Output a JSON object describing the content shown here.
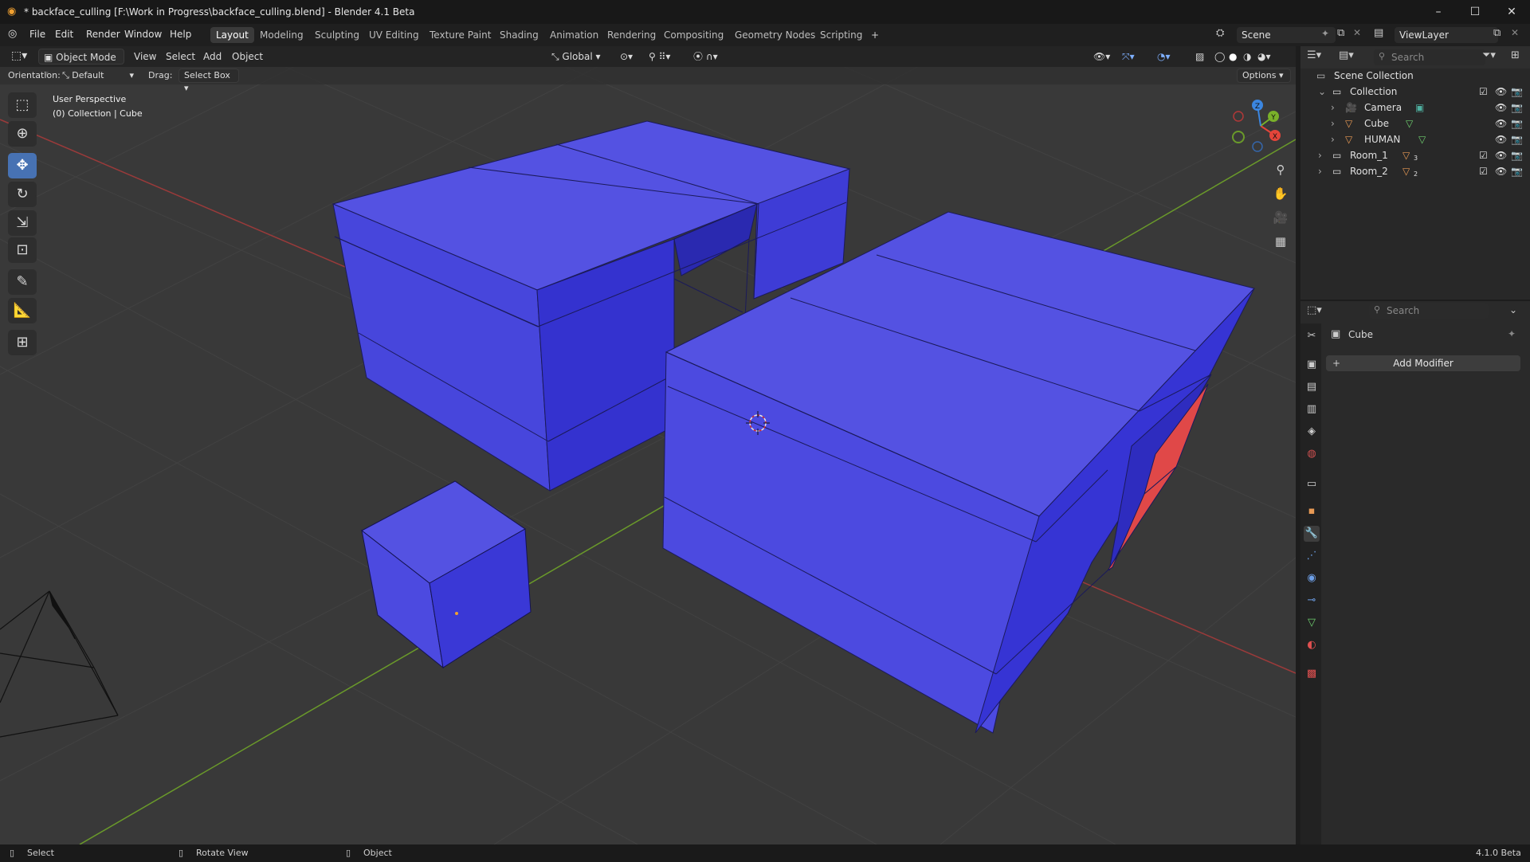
{
  "window": {
    "title": "* backface_culling [F:\\Work in Progress\\backface_culling.blend] - Blender 4.1 Beta",
    "controls": [
      "–",
      "☐",
      "✕"
    ]
  },
  "menubar": {
    "menus": [
      "File",
      "Edit",
      "Render",
      "Window",
      "Help"
    ],
    "workspaces": [
      "Layout",
      "Modeling",
      "Sculpting",
      "UV Editing",
      "Texture Paint",
      "Shading",
      "Animation",
      "Rendering",
      "Compositing",
      "Geometry Nodes",
      "Scripting"
    ],
    "active_workspace": "Layout",
    "add_workspace": "+",
    "scene": "Scene",
    "view_layer": "ViewLayer"
  },
  "viewport_header": {
    "mode": "Object Mode",
    "menus": [
      "View",
      "Select",
      "Add",
      "Object"
    ],
    "transform_orientation": "Global",
    "options_label": "Options"
  },
  "tool_settings": {
    "orientation_label": "Orientation:",
    "orientation_value": "Default",
    "drag_label": "Drag:",
    "drag_value": "Select Box"
  },
  "viewport_overlay": {
    "view_name": "User Perspective",
    "object_info": "(0) Collection | Cube"
  },
  "gizmo": {
    "axes": [
      "X",
      "Y",
      "Z"
    ]
  },
  "outliner": {
    "search_placeholder": "Search",
    "root": "Scene Collection",
    "items": [
      {
        "name": "Collection",
        "depth": 0
      },
      {
        "name": "Camera",
        "depth": 1
      },
      {
        "name": "Cube",
        "depth": 1
      },
      {
        "name": "HUMAN",
        "depth": 1
      },
      {
        "name": "Room_1",
        "depth": 0,
        "badge": "3"
      },
      {
        "name": "Room_2",
        "depth": 0,
        "badge": "2"
      }
    ]
  },
  "properties": {
    "search_placeholder": "Search",
    "object_name": "Cube",
    "add_modifier_label": "Add Modifier",
    "add_icon": "+"
  },
  "statusbar": {
    "items": [
      "Select",
      "Rotate View",
      "Object"
    ],
    "version": "4.1.0 Beta"
  },
  "colors": {
    "mesh_face": "#4b49e6",
    "backface_red": "#e04848",
    "active_tool": "#4772b3",
    "axis_x": "#e4453a",
    "axis_y": "#7ab12a",
    "axis_z": "#3b86e0"
  }
}
